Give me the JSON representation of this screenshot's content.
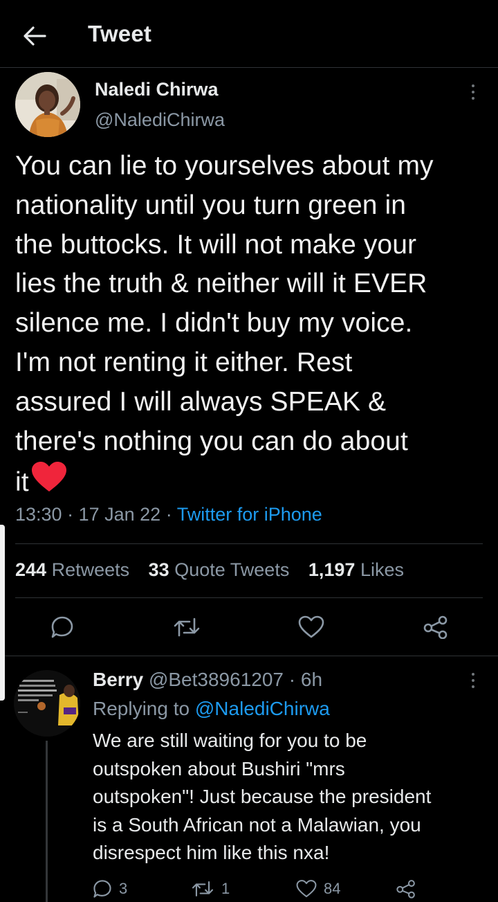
{
  "header": {
    "title": "Tweet",
    "back_icon": "arrow-left-icon"
  },
  "tweet": {
    "author_name": "Naledi Chirwa",
    "author_handle": "@NalediChirwa",
    "lines": [
      "You can lie to yourselves about my",
      "nationality until you turn green in",
      "the buttocks. It will not make your",
      "lies the truth & neither will it EVER",
      "silence me. I didn't buy my voice.",
      "I'm not renting it either. Rest",
      "assured I will always SPEAK &",
      "there's nothing you can do about",
      "it"
    ],
    "emoji": "red-heart-icon",
    "time": "13:30",
    "date": "17 Jan 22",
    "source": "Twitter for iPhone",
    "stats": {
      "retweets_count": "244",
      "retweets_label": "Retweets",
      "quotes_count": "33",
      "quotes_label": "Quote Tweets",
      "likes_count": "1,197",
      "likes_label": "Likes"
    }
  },
  "reply": {
    "name": "Berry",
    "handle": "@Bet38961207",
    "age": "6h",
    "replying_prefix": "Replying to",
    "replying_to": "@NalediChirwa",
    "lines": [
      "We are still waiting for you to be",
      "outspoken about Bushiri \"mrs",
      "outspoken\"! Just because the president",
      "is a South African not a Malawian, you",
      "disrespect him like this nxa!"
    ],
    "reply_count": "3",
    "retweet_count": "1",
    "like_count": "84"
  },
  "colors": {
    "background": "#000000",
    "text": "#e7e9ea",
    "secondary": "#8b98a5",
    "accent": "#1d9bf0",
    "divider": "#2f3336",
    "heart": "#f0253b"
  }
}
